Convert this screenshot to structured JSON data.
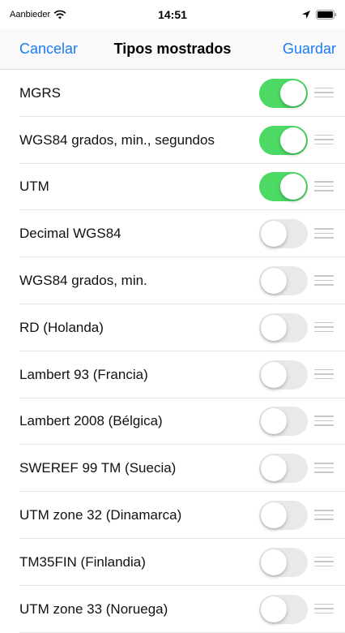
{
  "status_bar": {
    "carrier": "Aanbieder",
    "time": "14:51"
  },
  "nav": {
    "cancel_label": "Cancelar",
    "title": "Tipos mostrados",
    "save_label": "Guardar"
  },
  "colors": {
    "accent": "#1a7cf5",
    "toggle_on": "#4cd964",
    "toggle_off": "#e9e9ea"
  },
  "rows": [
    {
      "label": "MGRS",
      "enabled": true
    },
    {
      "label": "WGS84 grados, min., segundos",
      "enabled": true
    },
    {
      "label": "UTM",
      "enabled": true
    },
    {
      "label": "Decimal WGS84",
      "enabled": false
    },
    {
      "label": "WGS84 grados, min.",
      "enabled": false
    },
    {
      "label": "RD (Holanda)",
      "enabled": false
    },
    {
      "label": "Lambert 93 (Francia)",
      "enabled": false
    },
    {
      "label": "Lambert 2008 (Bélgica)",
      "enabled": false
    },
    {
      "label": "SWEREF 99 TM (Suecia)",
      "enabled": false
    },
    {
      "label": "UTM zone 32 (Dinamarca)",
      "enabled": false
    },
    {
      "label": "TM35FIN (Finlandia)",
      "enabled": false
    },
    {
      "label": "UTM zone 33 (Noruega)",
      "enabled": false
    }
  ]
}
